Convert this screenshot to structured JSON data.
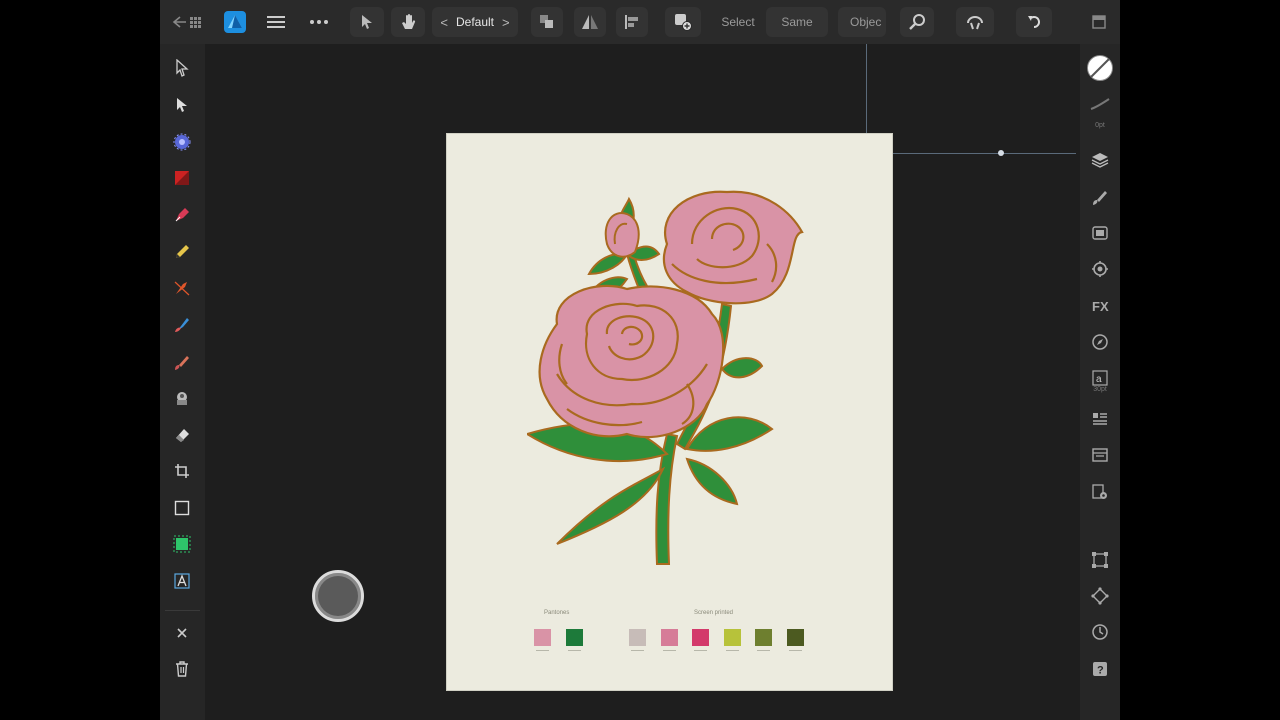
{
  "toolbar": {
    "persona_label": "Default",
    "select_label": "Select",
    "same_label": "Same",
    "object_label": "Objec"
  },
  "right_panel": {
    "stroke_width": "0pt",
    "text_size": "30pt"
  },
  "document": {
    "swatch_group_1_label": "Pantones",
    "swatch_group_2_label": "Screen printed",
    "swatches_1": [
      "#d993a6",
      "#1d7a3a"
    ],
    "swatches_2": [
      "#c7bcb8",
      "#d67c98",
      "#d33a6b",
      "#b7c23a",
      "#6e7f2f",
      "#4c5a20"
    ]
  },
  "colors": {
    "accent": "#2aa3e3",
    "petal": "#d993a6",
    "leaf": "#2f8f3a",
    "outline": "#a96a1f",
    "paper": "#ecebdf"
  }
}
